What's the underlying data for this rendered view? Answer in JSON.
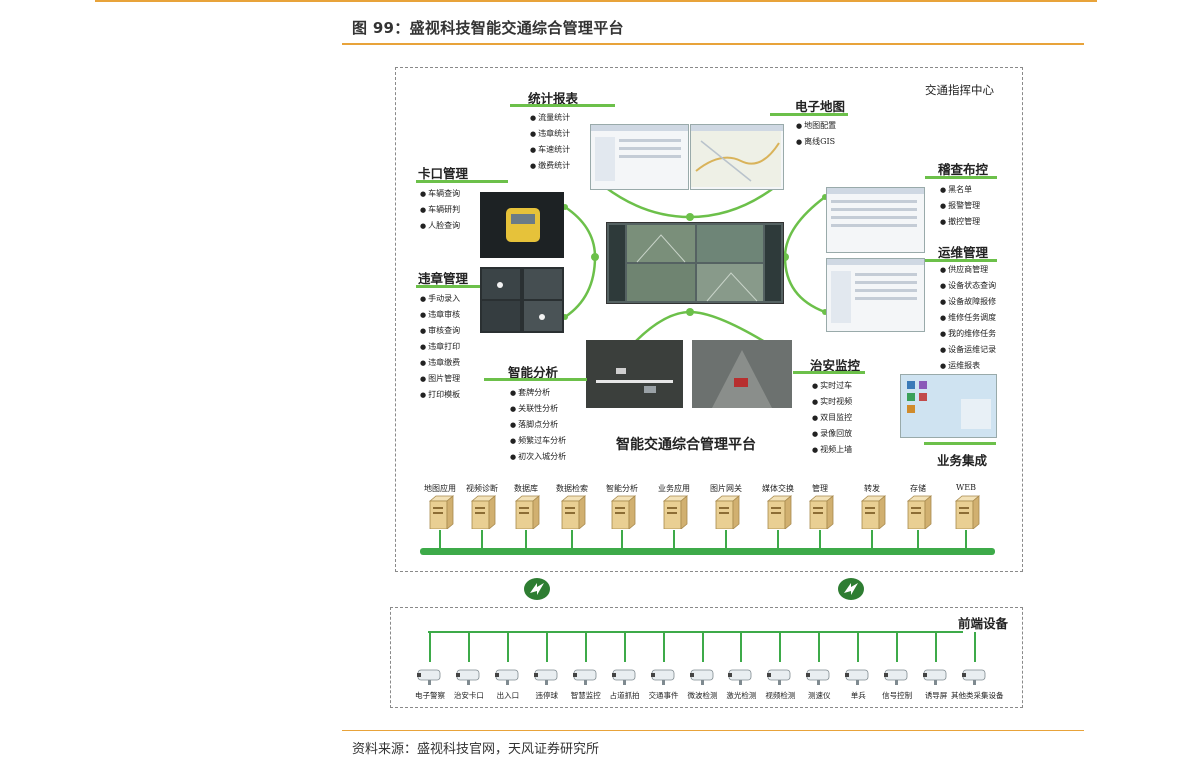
{
  "figure_title": "图 99：盛视科技智能交通综合管理平台",
  "source": "资料来源：盛视科技官网，天风证券研究所",
  "center": {
    "label": "交通指挥中心",
    "platform_label": "智能交通综合管理平台",
    "modules": {
      "stats": {
        "title": "统计报表",
        "items": [
          "流量统计",
          "违章统计",
          "车速统计",
          "缴费统计"
        ]
      },
      "map": {
        "title": "电子地图",
        "items": [
          "地图配置",
          "离线GIS"
        ]
      },
      "checkpoint": {
        "title": "卡口管理",
        "items": [
          "车辆查询",
          "车辆研判",
          "人脸查询"
        ]
      },
      "violation": {
        "title": "违章管理",
        "items": [
          "手动录入",
          "违章审核",
          "审核查询",
          "违章打印",
          "违章缴费",
          "图片管理",
          "打印模板"
        ]
      },
      "control": {
        "title": "稽查布控",
        "items": [
          "黑名单",
          "报警管理",
          "撤控管理"
        ]
      },
      "ops": {
        "title": "运维管理",
        "items": [
          "供应商管理",
          "设备状态查询",
          "设备故障报修",
          "维修任务调度",
          "我的维修任务",
          "设备运维记录",
          "运维报表"
        ]
      },
      "analysis": {
        "title": "智能分析",
        "items": [
          "套牌分析",
          "关联性分析",
          "落脚点分析",
          "频繁过车分析",
          "初次入城分析"
        ]
      },
      "security": {
        "title": "治安监控",
        "items": [
          "实时过车",
          "实时视频",
          "双目监控",
          "录像回放",
          "视频上墙"
        ]
      },
      "integration": {
        "title": "业务集成"
      }
    },
    "servers": [
      "地图应用",
      "视频诊断",
      "数据库",
      "数据检索",
      "智能分析",
      "业务应用",
      "图片网关",
      "媒体交换",
      "管理",
      "转发",
      "存储",
      "WEB"
    ]
  },
  "front": {
    "label": "前端设备",
    "devices": [
      "电子警察",
      "治安卡口",
      "出入口",
      "违停球",
      "智慧监控",
      "占道抓拍",
      "交通事件",
      "微波检测",
      "激光检测",
      "视频检测",
      "测速仪",
      "单兵",
      "信号控制",
      "诱导屏",
      "其他类采集设备"
    ]
  },
  "colors": {
    "accent_orange": "#e8a33a",
    "line_green": "#6cc04a",
    "bus_green": "#3daa49",
    "link_green": "#2e7d32"
  },
  "icons": {
    "server": "server-icon",
    "link": "network-link-icon",
    "camera": "camera-icon"
  }
}
